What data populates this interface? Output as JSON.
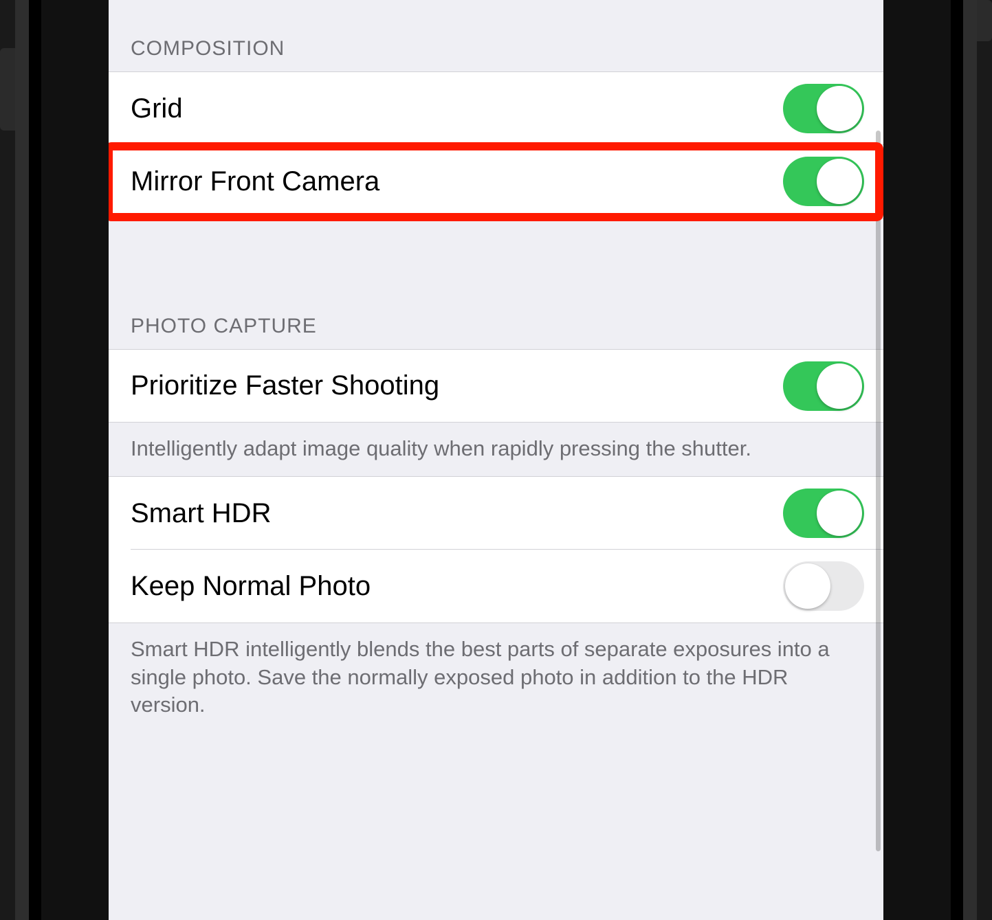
{
  "sections": {
    "composition": {
      "header": "Composition",
      "items": {
        "grid": {
          "label": "Grid",
          "on": true
        },
        "mirror": {
          "label": "Mirror Front Camera",
          "on": true,
          "highlighted": true
        }
      }
    },
    "photo_capture": {
      "header": "Photo Capture",
      "items": {
        "prioritize": {
          "label": "Prioritize Faster Shooting",
          "on": true
        },
        "smart_hdr": {
          "label": "Smart HDR",
          "on": true
        },
        "keep_normal": {
          "label": "Keep Normal Photo",
          "on": false
        }
      },
      "footer_prioritize": "Intelligently adapt image quality when rapidly pressing the shutter.",
      "footer_hdr": "Smart HDR intelligently blends the best parts of separate exposures into a single photo. Save the normally exposed photo in addition to the HDR version."
    }
  },
  "colors": {
    "switch_on": "#34c759",
    "highlight": "#ff1a00",
    "bg": "#efeff4"
  }
}
